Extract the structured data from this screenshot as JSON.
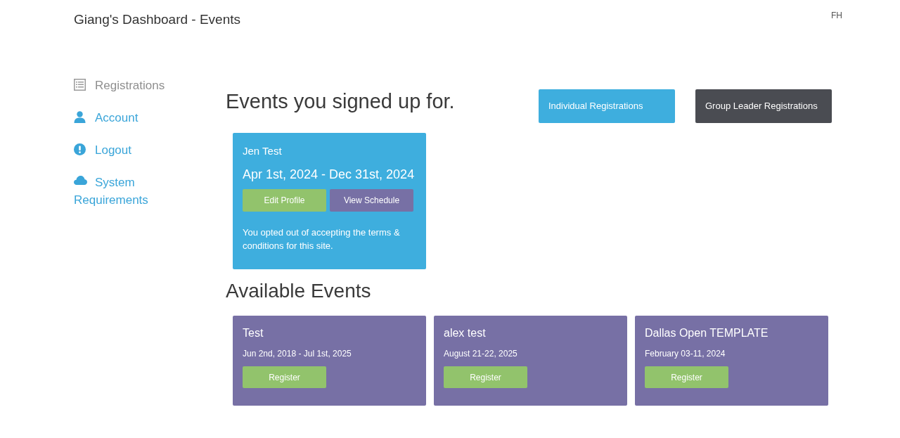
{
  "header": {
    "title": "Giang's Dashboard - Events",
    "user_initials": "FH"
  },
  "sidebar": {
    "items": [
      {
        "label": "Registrations",
        "selected": true
      },
      {
        "label": "Account",
        "selected": false
      },
      {
        "label": "Logout",
        "selected": false
      },
      {
        "label": "System Requirements",
        "selected": false
      }
    ]
  },
  "signed_up": {
    "heading": "Events you signed up for.",
    "view_buttons": [
      {
        "label": "Individual Registrations",
        "selected": true
      },
      {
        "label": "Group Leader Registrations",
        "selected": false
      }
    ],
    "cards": [
      {
        "name": "Jen Test",
        "dates": "Apr 1st, 2024 - Dec 31st, 2024",
        "buttons": [
          "Edit Profile",
          "View Schedule"
        ],
        "note": "You opted out of accepting the terms & conditions for this site."
      }
    ]
  },
  "available": {
    "heading": "Available Events",
    "events": [
      {
        "name": "Test",
        "dates": "Jun 2nd, 2018 - Jul 1st, 2025",
        "button": "Register"
      },
      {
        "name": "alex test",
        "dates": "August 21-22, 2025",
        "button": "Register"
      },
      {
        "name": "Dallas Open TEMPLATE",
        "dates": "February 03-11, 2024",
        "button": "Register"
      }
    ]
  }
}
